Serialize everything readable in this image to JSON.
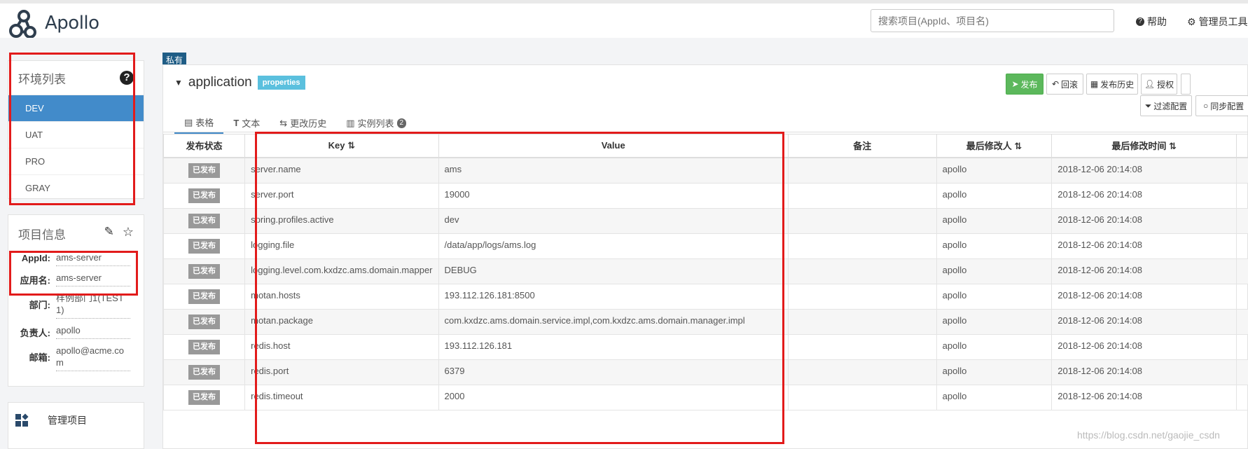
{
  "header": {
    "app_name": "Apollo",
    "search_placeholder": "搜索项目(AppId、项目名)",
    "help_label": "帮助",
    "admin_label": "管理员工具"
  },
  "env_panel": {
    "title": "环境列表",
    "items": [
      {
        "label": "DEV",
        "active": true
      },
      {
        "label": "UAT",
        "active": false
      },
      {
        "label": "PRO",
        "active": false
      },
      {
        "label": "GRAY",
        "active": false
      }
    ]
  },
  "project_info": {
    "title": "项目信息",
    "fields": [
      {
        "key": "AppId:",
        "value": "ams-server"
      },
      {
        "key": "应用名:",
        "value": "ams-server"
      },
      {
        "key": "部门:",
        "value": "样例部门1(TEST1)"
      },
      {
        "key": "负责人:",
        "value": "apollo"
      },
      {
        "key": "邮箱:",
        "value": "apollo@acme.com"
      }
    ]
  },
  "manage": {
    "label": "管理项目"
  },
  "namespace": {
    "visibility": "私有",
    "name": "application",
    "format": "properties",
    "buttons": {
      "publish": "发布",
      "rollback": "回滚",
      "history": "发布历史",
      "grant": "授权",
      "filter": "过滤配置",
      "sync": "同步配置"
    },
    "tabs": [
      {
        "label": "表格",
        "active": true
      },
      {
        "label": "文本",
        "active": false
      },
      {
        "label": "更改历史",
        "active": false
      },
      {
        "label": "实例列表",
        "active": false,
        "badge": "2"
      }
    ]
  },
  "table": {
    "headers": [
      "发布状态",
      "Key ⇅",
      "Value",
      "备注",
      "最后修改人 ⇅",
      "最后修改时间 ⇅"
    ],
    "rows": [
      {
        "status": "已发布",
        "key": "server.name",
        "value": "ams",
        "comment": "",
        "modifier": "apollo",
        "time": "2018-12-06 20:14:08"
      },
      {
        "status": "已发布",
        "key": "server.port",
        "value": "19000",
        "comment": "",
        "modifier": "apollo",
        "time": "2018-12-06 20:14:08"
      },
      {
        "status": "已发布",
        "key": "spring.profiles.active",
        "value": "dev",
        "comment": "",
        "modifier": "apollo",
        "time": "2018-12-06 20:14:08"
      },
      {
        "status": "已发布",
        "key": "logging.file",
        "value": "/data/app/logs/ams.log",
        "comment": "",
        "modifier": "apollo",
        "time": "2018-12-06 20:14:08"
      },
      {
        "status": "已发布",
        "key": "logging.level.com.kxdzc.ams.domain.mapper",
        "value": "DEBUG",
        "comment": "",
        "modifier": "apollo",
        "time": "2018-12-06 20:14:08"
      },
      {
        "status": "已发布",
        "key": "motan.hosts",
        "value": "193.112.126.181:8500",
        "comment": "",
        "modifier": "apollo",
        "time": "2018-12-06 20:14:08"
      },
      {
        "status": "已发布",
        "key": "motan.package",
        "value": "com.kxdzc.ams.domain.service.impl,com.kxdzc.ams.domain.manager.impl",
        "comment": "",
        "modifier": "apollo",
        "time": "2018-12-06 20:14:08"
      },
      {
        "status": "已发布",
        "key": "redis.host",
        "value": "193.112.126.181",
        "comment": "",
        "modifier": "apollo",
        "time": "2018-12-06 20:14:08"
      },
      {
        "status": "已发布",
        "key": "redis.port",
        "value": "6379",
        "comment": "",
        "modifier": "apollo",
        "time": "2018-12-06 20:14:08"
      },
      {
        "status": "已发布",
        "key": "redis.timeout",
        "value": "2000",
        "comment": "",
        "modifier": "apollo",
        "time": "2018-12-06 20:14:08"
      }
    ]
  },
  "watermark": "https://blog.csdn.net/gaojie_csdn"
}
